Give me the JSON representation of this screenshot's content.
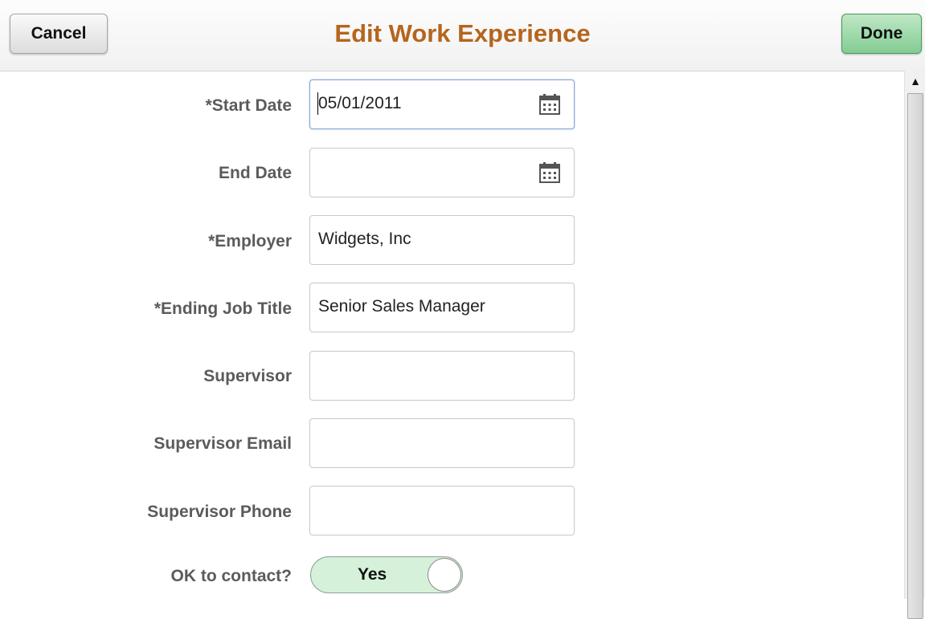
{
  "header": {
    "title": "Edit Work Experience",
    "cancel_label": "Cancel",
    "done_label": "Done"
  },
  "form": {
    "start_date": {
      "label": "*Start Date",
      "value": "05/01/2011",
      "icon": "calendar-icon"
    },
    "end_date": {
      "label": "End Date",
      "value": "",
      "icon": "calendar-icon"
    },
    "employer": {
      "label": "*Employer",
      "value": "Widgets, Inc"
    },
    "ending_job_title": {
      "label": "*Ending Job Title",
      "value": "Senior Sales Manager"
    },
    "supervisor": {
      "label": "Supervisor",
      "value": ""
    },
    "supervisor_email": {
      "label": "Supervisor Email",
      "value": ""
    },
    "supervisor_phone": {
      "label": "Supervisor Phone",
      "value": ""
    },
    "ok_to_contact": {
      "label": "OK to contact?",
      "value": "Yes"
    }
  },
  "colors": {
    "title": "#b5651d",
    "done_button": "#82cc92",
    "toggle_on": "#d6f1da",
    "label": "#5b5b5b"
  }
}
